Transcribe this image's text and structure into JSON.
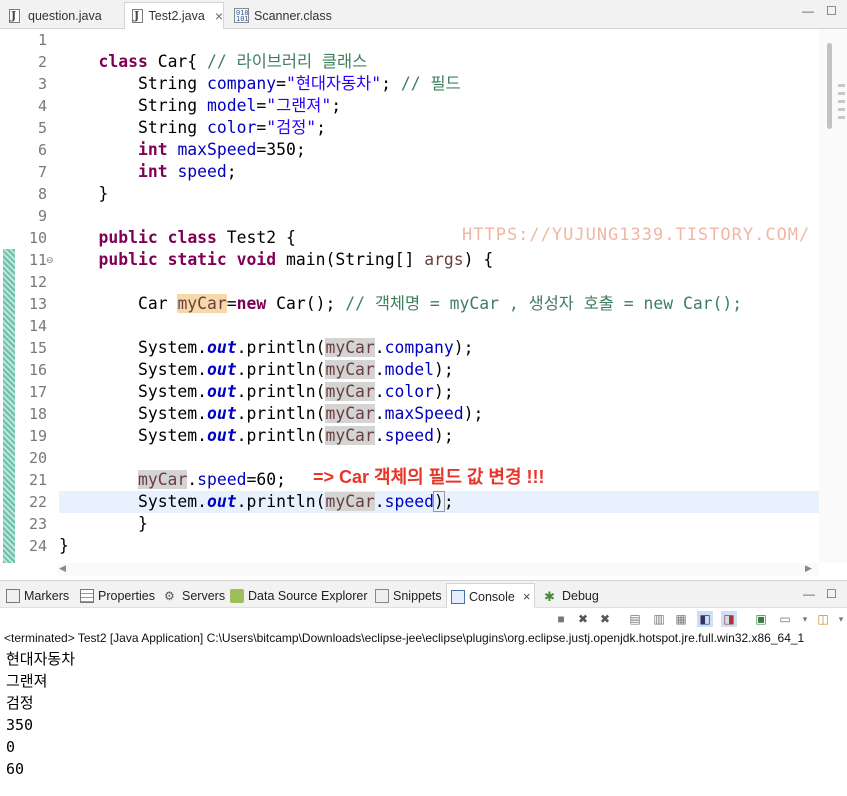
{
  "editor_tabs": [
    {
      "label": "question.java",
      "icon": "java-file-icon",
      "active": false
    },
    {
      "label": "Test2.java",
      "icon": "java-file-icon",
      "active": true,
      "close": "×"
    },
    {
      "label": "Scanner.class",
      "icon": "class-file-icon",
      "active": false
    }
  ],
  "editor_controls": {
    "minimize": "—",
    "maximize": "☐"
  },
  "line_numbers": [
    "1",
    "2",
    "3",
    "4",
    "5",
    "6",
    "7",
    "8",
    "9",
    "10",
    "11",
    "12",
    "13",
    "14",
    "15",
    "16",
    "17",
    "18",
    "19",
    "20",
    "21",
    "22",
    "23",
    "24"
  ],
  "code": {
    "l2": {
      "kw": "class",
      "name": " Car{ ",
      "comment": "// 라이브러리 클래스"
    },
    "l3": {
      "type": "String ",
      "field": "company",
      "eq": "=",
      "str": "\"현대자동차\"",
      "semi": "; ",
      "comment": "// 필드"
    },
    "l4": {
      "type": "String ",
      "field": "model",
      "eq": "=",
      "str": "\"그랜져\"",
      "semi": ";"
    },
    "l5": {
      "type": "String ",
      "field": "color",
      "eq": "=",
      "str": "\"검정\"",
      "semi": ";"
    },
    "l6": {
      "kw": "int",
      "field": "maxSpeed",
      "rest": "=350;"
    },
    "l7": {
      "kw": "int",
      "field": "speed",
      "rest": ";"
    },
    "l8": "}",
    "l10": {
      "kw1": "public",
      "kw2": "class",
      "rest": " Test2 {"
    },
    "l11": {
      "kw1": "public",
      "kw2": "static",
      "kw3": "void",
      "rest1": " main(String[] ",
      "param": "args",
      "rest2": ") {"
    },
    "l13": {
      "pre": "Car ",
      "var": "myCar",
      "eq": "=",
      "kw": "new",
      "rest": " Car(); ",
      "comment": "// 객체명 = myCar , 생성자 호출 = new Car();"
    },
    "println_pre": "System.",
    "out": "out",
    "println_mid": ".println(",
    "var": "myCar",
    "fields": [
      "company",
      "model",
      "color",
      "maxSpeed",
      "speed"
    ],
    "println_end": ");",
    "l21": {
      "field": "speed",
      "rest": "=60;"
    },
    "l23": "}",
    "l24": "}"
  },
  "watermark": "HTTPS://YUJUNG1339.TISTORY.COM/",
  "annotation": "=> Car 객체의 필드 값 변경 !!!",
  "panel_tabs": [
    {
      "label": "Markers",
      "icon": "markers-icon"
    },
    {
      "label": "Properties",
      "icon": "properties-icon"
    },
    {
      "label": "Servers",
      "icon": "servers-icon"
    },
    {
      "label": "Data Source Explorer",
      "icon": "data-source-icon"
    },
    {
      "label": "Snippets",
      "icon": "snippets-icon"
    },
    {
      "label": "Console",
      "icon": "console-icon",
      "active": true,
      "close": "×"
    },
    {
      "label": "Debug",
      "icon": "debug-icon"
    }
  ],
  "terminated_text": "<terminated> Test2 [Java Application] C:\\Users\\bitcamp\\Downloads\\eclipse-jee\\eclipse\\plugins\\org.eclipse.justj.openjdk.hotspot.jre.full.win32.x86_64_1",
  "console_output": [
    "현대자동차",
    "그랜져",
    "검정",
    "350",
    "0",
    "60"
  ],
  "colors": {
    "keyword": "#7f0055",
    "field": "#0000c0",
    "string": "#2a00ff",
    "comment": "#3f7f5f",
    "annotation": "#e8352b"
  }
}
